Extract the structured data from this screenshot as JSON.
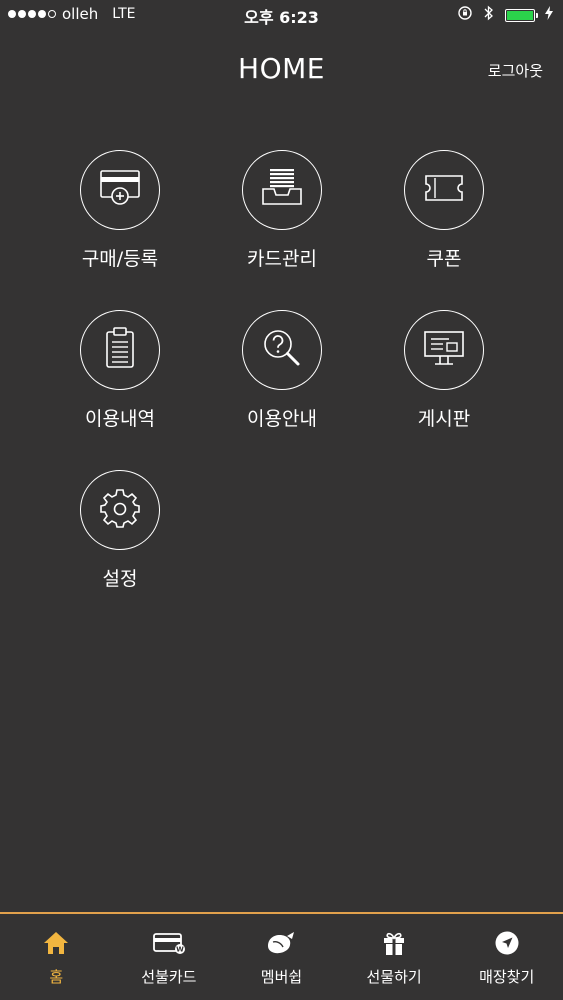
{
  "status_bar": {
    "carrier": "olleh",
    "network": "LTE",
    "time": "오후 6:23"
  },
  "header": {
    "title": "HOME",
    "logout_label": "로그아웃"
  },
  "menu": [
    {
      "label": "구매/등록",
      "icon": "card-add-icon"
    },
    {
      "label": "카드관리",
      "icon": "card-stack-icon"
    },
    {
      "label": "쿠폰",
      "icon": "coupon-icon"
    },
    {
      "label": "이용내역",
      "icon": "clipboard-icon"
    },
    {
      "label": "이용안내",
      "icon": "help-search-icon"
    },
    {
      "label": "게시판",
      "icon": "board-icon"
    },
    {
      "label": "설정",
      "icon": "gear-icon"
    }
  ],
  "tabs": [
    {
      "label": "홈",
      "icon": "home-icon",
      "active": true
    },
    {
      "label": "선불카드",
      "icon": "prepaid-card-icon",
      "active": false
    },
    {
      "label": "멤버쉽",
      "icon": "membership-icon",
      "active": false
    },
    {
      "label": "선물하기",
      "icon": "gift-icon",
      "active": false
    },
    {
      "label": "매장찾기",
      "icon": "location-icon",
      "active": false
    }
  ],
  "colors": {
    "background": "#343333",
    "accent": "#f2b640",
    "tab_border": "#e2a14c",
    "battery": "#2bd34b"
  }
}
